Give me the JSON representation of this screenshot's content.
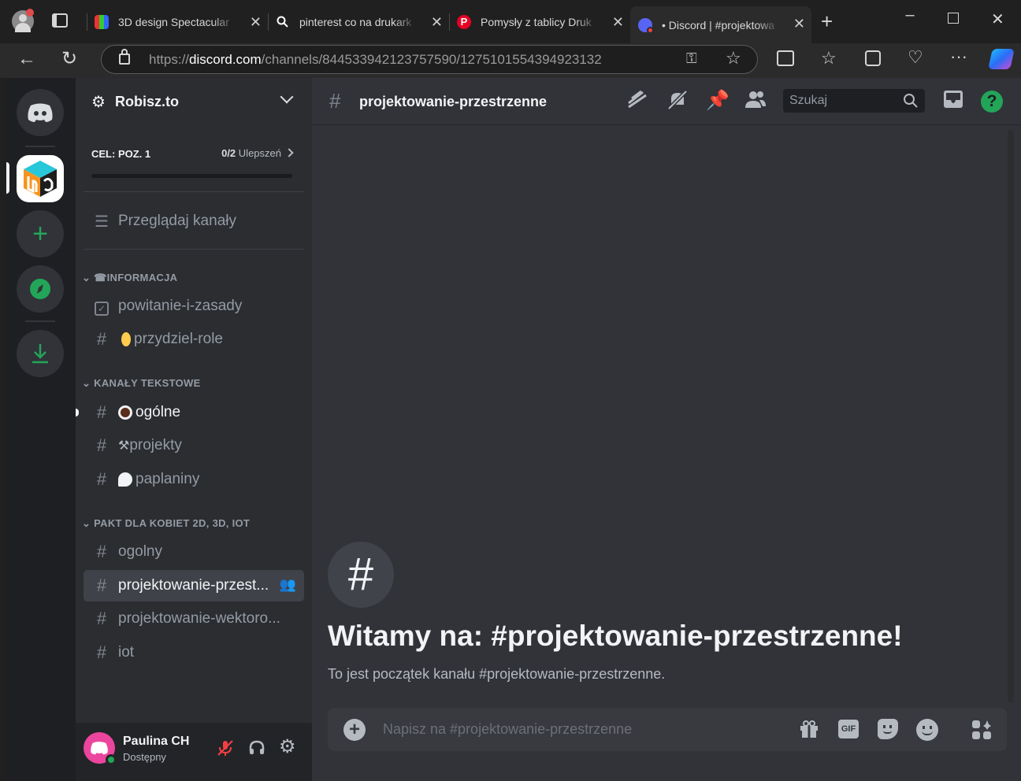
{
  "browser": {
    "tabs": [
      {
        "label": "3D design Spectacular"
      },
      {
        "label": "pinterest co na drukark"
      },
      {
        "label": "Pomysły z tablicy Druk"
      },
      {
        "label": "• Discord | #projektowa"
      }
    ],
    "url_scheme": "https://",
    "url_host": "discord.com",
    "url_path": "/channels/844533942123757590/1275101554394923132"
  },
  "server": {
    "name": "Robisz.to",
    "boost_goal": "CEL: POZ. 1",
    "boost_count": "0/2",
    "boost_word": "Ulepszeń",
    "browse_label": "Przeglądaj kanały"
  },
  "categories": [
    {
      "name": "☎INFORMACJA"
    },
    {
      "name": "KANAŁY TEKSTOWE"
    },
    {
      "name": "PAKT DLA KOBIET 2D, 3D, IOT"
    }
  ],
  "channels": {
    "info": [
      "powitanie-i-zasady",
      "przydziel-role"
    ],
    "text": [
      "ogólne",
      "projekty",
      "paplaniny"
    ],
    "pakt": [
      "ogolny",
      "projektowanie-przest...",
      "projektowanie-wektoro...",
      "iot"
    ]
  },
  "header": {
    "channel": "projektowanie-przestrzenne",
    "search_placeholder": "Szukaj"
  },
  "welcome": {
    "title": "Witamy na: #projektowanie-przestrzenne!",
    "subtitle": "To jest początek kanału #projektowanie-przestrzenne."
  },
  "composer": {
    "placeholder": "Napisz na #projektowanie-przestrzenne",
    "gif_label": "GIF"
  },
  "user": {
    "name": "Paulina CH",
    "status": "Dostępny"
  },
  "colors": {
    "blurple": "#5865f2",
    "green": "#23a559",
    "selected": "#404249",
    "mute_red": "#f23f43"
  }
}
